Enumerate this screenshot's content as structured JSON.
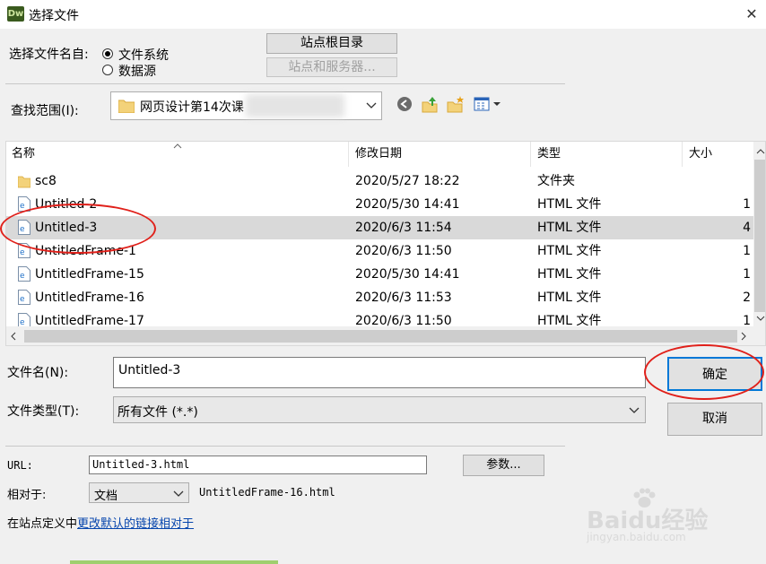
{
  "window": {
    "app_icon": "Dw",
    "title": "选择文件",
    "close_icon": "✕"
  },
  "source": {
    "label": "选择文件名自:",
    "options": [
      "文件系统",
      "数据源"
    ],
    "selected_index": 0,
    "site_root_button": "站点根目录",
    "server_button": "站点和服务器..."
  },
  "lookin": {
    "label": "查找范围(I):",
    "value": "网页设计第14次课"
  },
  "columns": {
    "name": "名称",
    "modified": "修改日期",
    "type": "类型",
    "size": "大小"
  },
  "files": [
    {
      "name": "sc8",
      "date": "2020/5/27 18:22",
      "type": "文件夹",
      "size": "",
      "icon": "folder-icon",
      "selected": false
    },
    {
      "name": "Untitled-2",
      "date": "2020/5/30 14:41",
      "type": "HTML 文件",
      "size": "1",
      "icon": "html-file-icon",
      "selected": false
    },
    {
      "name": "Untitled-3",
      "date": "2020/6/3 11:54",
      "type": "HTML 文件",
      "size": "4",
      "icon": "html-file-icon",
      "selected": true
    },
    {
      "name": "UntitledFrame-1",
      "date": "2020/6/3 11:50",
      "type": "HTML 文件",
      "size": "1",
      "icon": "html-file-icon",
      "selected": false
    },
    {
      "name": "UntitledFrame-15",
      "date": "2020/5/30 14:41",
      "type": "HTML 文件",
      "size": "1",
      "icon": "html-file-icon",
      "selected": false
    },
    {
      "name": "UntitledFrame-16",
      "date": "2020/6/3 11:53",
      "type": "HTML 文件",
      "size": "2",
      "icon": "html-file-icon",
      "selected": false
    },
    {
      "name": "UntitledFrame-17",
      "date": "2020/6/3 11:50",
      "type": "HTML 文件",
      "size": "1",
      "icon": "html-file-icon",
      "selected": false
    }
  ],
  "filename": {
    "label": "文件名(N):",
    "value": "Untitled-3"
  },
  "filetype": {
    "label": "文件类型(T):",
    "value": "所有文件 (*.*)"
  },
  "buttons": {
    "ok": "确定",
    "cancel": "取消",
    "params": "参数..."
  },
  "url": {
    "label": "URL:",
    "value": "Untitled-3.html"
  },
  "relative": {
    "label": "相对于:",
    "value": "文档",
    "target": "UntitledFrame-16.html"
  },
  "footer": {
    "prefix": "在站点定义中",
    "link": "更改默认的链接相对于"
  },
  "watermark": {
    "brand": "Baidu经验",
    "url": "jingyan.baidu.com"
  },
  "colors": {
    "highlight": "#e0201a",
    "selected_row": "#d9d9d9",
    "link": "#0645ad"
  }
}
